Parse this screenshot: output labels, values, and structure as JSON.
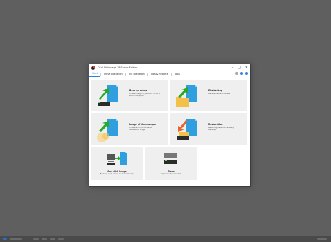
{
  "window": {
    "title": "O&O DiskImage 18 Server Edition",
    "controls": [
      "–",
      "□",
      "✕"
    ]
  },
  "tabs": [
    {
      "label": "Start",
      "active": true
    },
    {
      "label": "Drive operation",
      "active": false
    },
    {
      "label": "File operation",
      "active": false
    },
    {
      "label": "Jobs & Reports",
      "active": false
    },
    {
      "label": "Tools",
      "active": false
    }
  ],
  "cards": {
    "backup_drives": {
      "title": "Back up drives",
      "desc": "Create image of partition, drive or entire computer"
    },
    "file_backup": {
      "title": "File backup",
      "desc": "Backup files and folders"
    },
    "image_changes": {
      "title": "Image of the changes",
      "desc": "Create an incremental or differential image"
    },
    "restoration": {
      "title": "Restoration",
      "desc": "Restoring data from existing backups"
    },
    "one_click": {
      "title": "One-click image",
      "desc": "Backing of all drives on the computer"
    },
    "clone": {
      "title": "Clone",
      "desc": "Duplicate drive or disk"
    }
  },
  "icons": {
    "green_arrow": "#29a829",
    "orange_arrow": "#e8652b",
    "blue_doc": "#2f9fe0",
    "folder": "#f3c04a",
    "drive": "#2b2b2b"
  }
}
